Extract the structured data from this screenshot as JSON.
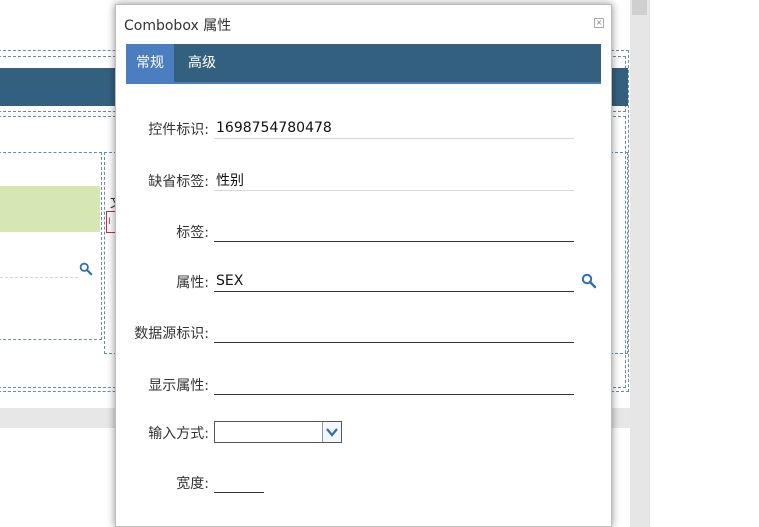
{
  "dialog": {
    "title": "Combobox 属性",
    "close_glyph": "×",
    "tabs": [
      {
        "label": "常规",
        "active": true
      },
      {
        "label": "高级",
        "active": false
      }
    ],
    "fields": {
      "control_id": {
        "label": "控件标识:",
        "value": "1698754780478"
      },
      "default_label": {
        "label": "缺省标签:",
        "value": "性别"
      },
      "label": {
        "label": "标签:",
        "value": ""
      },
      "property": {
        "label": "属性:",
        "value": "SEX"
      },
      "datasource_id": {
        "label": "数据源标识:",
        "value": ""
      },
      "display_property": {
        "label": "显示属性:",
        "value": ""
      },
      "input_mode": {
        "label": "输入方式:",
        "value": ""
      },
      "width": {
        "label": "宽度:",
        "value": ""
      }
    }
  },
  "background": {
    "glyph": "文",
    "red_box_text": "I"
  },
  "colors": {
    "tab_bar": "#34607f",
    "tab_active": "#4a7ec0",
    "search_icon": "#2e6db4"
  },
  "icons": [
    "close-icon",
    "search-icon",
    "chevron-down-icon"
  ]
}
